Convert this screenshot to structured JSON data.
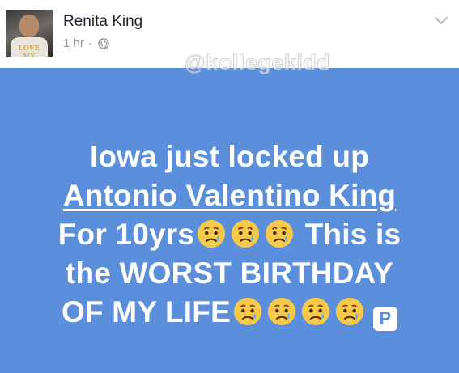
{
  "post": {
    "author": "Renita King",
    "timestamp": "1 hr",
    "separator": "·",
    "privacy_icon": "globe-icon",
    "menu_icon": "chevron-down-icon",
    "avatar_caption": "LOVE MY",
    "watermark": "@kollegekidd"
  },
  "status": {
    "background_color": "#5b8fdc",
    "text_color": "#ffffff",
    "line1": "Iowa just locked up",
    "line2_link": "Antonio Valentino King",
    "line3_text": "For 10yrs",
    "line3_tail": "This is",
    "line4": "the WORST BIRTHDAY",
    "line5_text": "OF MY LIFE",
    "emoji_icon": "crying-face-emoji",
    "parking_label": "P"
  }
}
